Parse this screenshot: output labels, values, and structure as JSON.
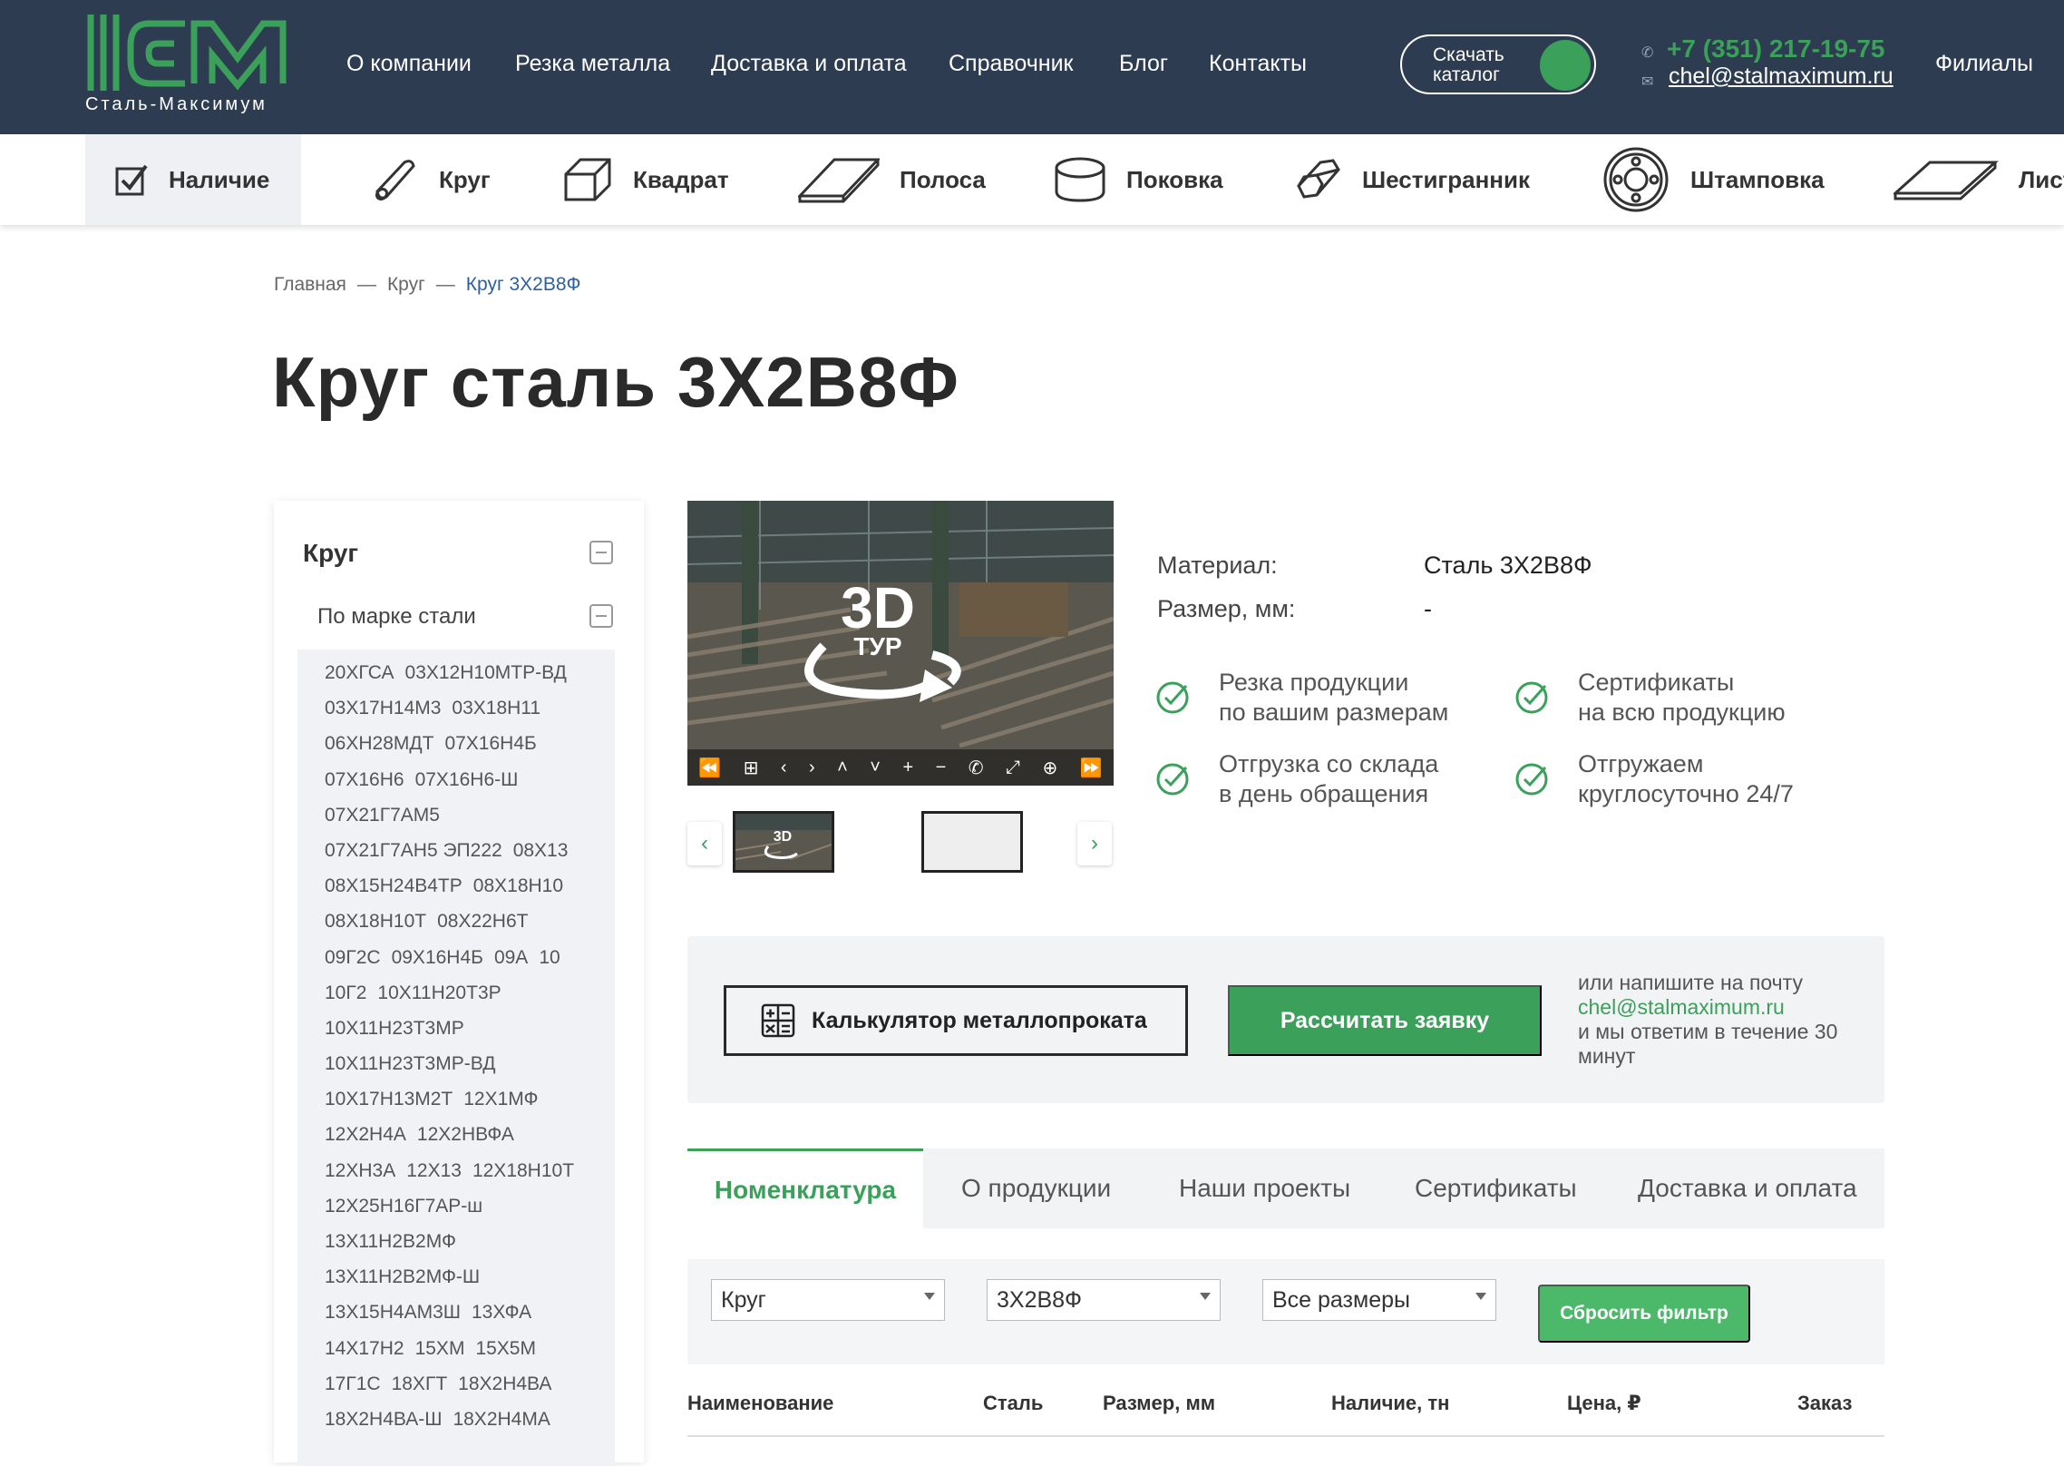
{
  "brand": {
    "name": "Сталь-Максимум",
    "accent": "#3aa05a",
    "header_bg": "#2e3c52"
  },
  "header": {
    "nav": [
      "О компании",
      "Резка металла",
      "Доставка и оплата",
      "Справочник",
      "Блог",
      "Контакты"
    ],
    "catalog_button": "Скачать каталог",
    "phone": "+7 (351) 217-19-75",
    "email": "chel@stalmaximum.ru",
    "branches": "Филиалы"
  },
  "categories": [
    {
      "label": "Наличие",
      "icon": "checkbox-icon",
      "active": true
    },
    {
      "label": "Круг",
      "icon": "rod-icon"
    },
    {
      "label": "Квадрат",
      "icon": "cube-icon"
    },
    {
      "label": "Полоса",
      "icon": "strip-icon"
    },
    {
      "label": "Поковка",
      "icon": "cylinder-icon"
    },
    {
      "label": "Шестигранник",
      "icon": "hexagon-bar-icon"
    },
    {
      "label": "Штамповка",
      "icon": "flange-icon"
    },
    {
      "label": "Лист",
      "icon": "sheet-icon"
    }
  ],
  "breadcrumbs": [
    "Главная",
    "Круг",
    "Круг 3Х2В8Ф"
  ],
  "breadcrumb_sep": "—",
  "page_title": "Круг сталь 3Х2В8Ф",
  "sidebar": {
    "title": "Круг",
    "subtitle": "По марке стали",
    "grades": [
      [
        "20ХГСА",
        "03Х12Н10МТР-ВД"
      ],
      [
        "03Х17Н14М3",
        "03Х18Н11"
      ],
      [
        "06ХН28МДТ",
        "07Х16Н4Б"
      ],
      [
        "07Х16Н6",
        "07Х16Н6-Ш"
      ],
      [
        "07Х21Г7АМ5"
      ],
      [
        "07Х21Г7АН5 ЭП222",
        "08Х13"
      ],
      [
        "08Х15Н24В4ТР",
        "08Х18Н10"
      ],
      [
        "08Х18Н10Т",
        "08Х22Н6Т"
      ],
      [
        "09Г2С",
        "09Х16Н4Б",
        "09А",
        "10"
      ],
      [
        "10Г2",
        "10Х11Н20Т3Р"
      ],
      [
        "10Х11Н23Т3МР"
      ],
      [
        "10Х11Н23Т3МР-ВД"
      ],
      [
        "10Х17Н13М2Т",
        "12Х1МФ"
      ],
      [
        "12Х2Н4А",
        "12Х2НВФА"
      ],
      [
        "12ХН3А",
        "12Х13",
        "12Х18Н10Т"
      ],
      [
        "12Х25Н16Г7АР-ш"
      ],
      [
        "13Х11Н2В2МФ"
      ],
      [
        "13Х11Н2В2МФ-Ш"
      ],
      [
        "13Х15Н4АМ3Ш",
        "13ХФА"
      ],
      [
        "14Х17Н2",
        "15ХМ",
        "15Х5М"
      ],
      [
        "17Г1С",
        "18ХГТ",
        "18Х2Н4ВА"
      ],
      [
        "18Х2Н4ВА-Ш",
        "18Х2Н4МА"
      ]
    ]
  },
  "gallery": {
    "badge_big": "3D",
    "badge_small": "ТУР",
    "prev": "‹",
    "next": "›"
  },
  "props": [
    {
      "label": "Материал:",
      "value": "Сталь 3Х2В8Ф"
    },
    {
      "label": "Размер, мм:",
      "value": "-"
    }
  ],
  "features": [
    {
      "line1": "Резка продукции",
      "line2": "по вашим размерам"
    },
    {
      "line1": "Сертификаты",
      "line2": "на всю продукцию"
    },
    {
      "line1": "Отгрузка со склада",
      "line2": "в день обращения"
    },
    {
      "line1": "Отгружаем",
      "line2": "круглосуточно 24/7"
    }
  ],
  "actions": {
    "calculator": "Калькулятор металлопроката",
    "request": "Рассчитать заявку",
    "note_pre": "или напишите на почту",
    "note_email": "chel@stalmaximum.ru",
    "note_post": "и мы ответим в течение 30 минут"
  },
  "tabs": [
    "Номенклатура",
    "О продукции",
    "Наши проекты",
    "Сертификаты",
    "Доставка и оплата"
  ],
  "filters": {
    "type": "Круг",
    "grade": "3Х2В8Ф",
    "size": "Все размеры",
    "reset": "Сбросить фильтр"
  },
  "table_headers": [
    "Наименование",
    "Сталь",
    "Размер, мм",
    "Наличие, тн",
    "Цена, ₽",
    "Заказ"
  ]
}
